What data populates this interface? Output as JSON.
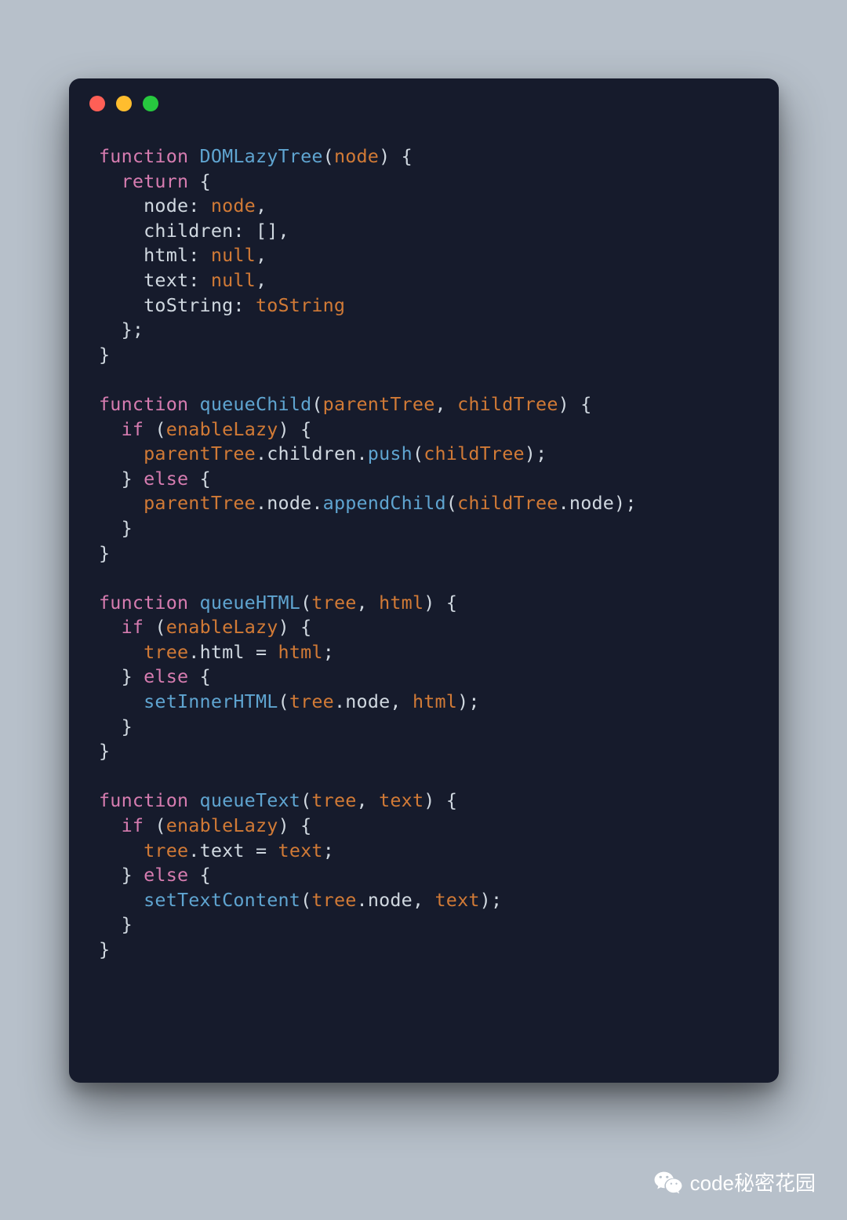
{
  "footer": {
    "text": "code秘密花园"
  },
  "code": {
    "tokens": [
      [
        {
          "t": "function ",
          "c": "kw"
        },
        {
          "t": "DOMLazyTree",
          "c": "fn"
        },
        {
          "t": "(",
          "c": "pn"
        },
        {
          "t": "node",
          "c": "prm"
        },
        {
          "t": ") {",
          "c": "pn"
        }
      ],
      [
        {
          "t": "  ",
          "c": "pn"
        },
        {
          "t": "return",
          "c": "kw"
        },
        {
          "t": " {",
          "c": "pn"
        }
      ],
      [
        {
          "t": "    node: ",
          "c": "pn"
        },
        {
          "t": "node",
          "c": "prm"
        },
        {
          "t": ",",
          "c": "pn"
        }
      ],
      [
        {
          "t": "    children: [],",
          "c": "pn"
        }
      ],
      [
        {
          "t": "    html: ",
          "c": "pn"
        },
        {
          "t": "null",
          "c": "nul"
        },
        {
          "t": ",",
          "c": "pn"
        }
      ],
      [
        {
          "t": "    text: ",
          "c": "pn"
        },
        {
          "t": "null",
          "c": "nul"
        },
        {
          "t": ",",
          "c": "pn"
        }
      ],
      [
        {
          "t": "    toString: ",
          "c": "pn"
        },
        {
          "t": "toString",
          "c": "prm"
        }
      ],
      [
        {
          "t": "  };",
          "c": "pn"
        }
      ],
      [
        {
          "t": "}",
          "c": "pn"
        }
      ],
      [
        {
          "t": "",
          "c": "pn"
        }
      ],
      [
        {
          "t": "function ",
          "c": "kw"
        },
        {
          "t": "queueChild",
          "c": "fn"
        },
        {
          "t": "(",
          "c": "pn"
        },
        {
          "t": "parentTree",
          "c": "prm"
        },
        {
          "t": ", ",
          "c": "pn"
        },
        {
          "t": "childTree",
          "c": "prm"
        },
        {
          "t": ") {",
          "c": "pn"
        }
      ],
      [
        {
          "t": "  ",
          "c": "pn"
        },
        {
          "t": "if",
          "c": "kw"
        },
        {
          "t": " (",
          "c": "pn"
        },
        {
          "t": "enableLazy",
          "c": "prm"
        },
        {
          "t": ") {",
          "c": "pn"
        }
      ],
      [
        {
          "t": "    ",
          "c": "pn"
        },
        {
          "t": "parentTree",
          "c": "prm"
        },
        {
          "t": ".children.",
          "c": "pn"
        },
        {
          "t": "push",
          "c": "fn"
        },
        {
          "t": "(",
          "c": "pn"
        },
        {
          "t": "childTree",
          "c": "prm"
        },
        {
          "t": ");",
          "c": "pn"
        }
      ],
      [
        {
          "t": "  } ",
          "c": "pn"
        },
        {
          "t": "else",
          "c": "kw"
        },
        {
          "t": " {",
          "c": "pn"
        }
      ],
      [
        {
          "t": "    ",
          "c": "pn"
        },
        {
          "t": "parentTree",
          "c": "prm"
        },
        {
          "t": ".node.",
          "c": "pn"
        },
        {
          "t": "appendChild",
          "c": "fn"
        },
        {
          "t": "(",
          "c": "pn"
        },
        {
          "t": "childTree",
          "c": "prm"
        },
        {
          "t": ".node);",
          "c": "pn"
        }
      ],
      [
        {
          "t": "  }",
          "c": "pn"
        }
      ],
      [
        {
          "t": "}",
          "c": "pn"
        }
      ],
      [
        {
          "t": "",
          "c": "pn"
        }
      ],
      [
        {
          "t": "function ",
          "c": "kw"
        },
        {
          "t": "queueHTML",
          "c": "fn"
        },
        {
          "t": "(",
          "c": "pn"
        },
        {
          "t": "tree",
          "c": "prm"
        },
        {
          "t": ", ",
          "c": "pn"
        },
        {
          "t": "html",
          "c": "prm"
        },
        {
          "t": ") {",
          "c": "pn"
        }
      ],
      [
        {
          "t": "  ",
          "c": "pn"
        },
        {
          "t": "if",
          "c": "kw"
        },
        {
          "t": " (",
          "c": "pn"
        },
        {
          "t": "enableLazy",
          "c": "prm"
        },
        {
          "t": ") {",
          "c": "pn"
        }
      ],
      [
        {
          "t": "    ",
          "c": "pn"
        },
        {
          "t": "tree",
          "c": "prm"
        },
        {
          "t": ".html = ",
          "c": "pn"
        },
        {
          "t": "html",
          "c": "prm"
        },
        {
          "t": ";",
          "c": "pn"
        }
      ],
      [
        {
          "t": "  } ",
          "c": "pn"
        },
        {
          "t": "else",
          "c": "kw"
        },
        {
          "t": " {",
          "c": "pn"
        }
      ],
      [
        {
          "t": "    ",
          "c": "pn"
        },
        {
          "t": "setInnerHTML",
          "c": "fn"
        },
        {
          "t": "(",
          "c": "pn"
        },
        {
          "t": "tree",
          "c": "prm"
        },
        {
          "t": ".node, ",
          "c": "pn"
        },
        {
          "t": "html",
          "c": "prm"
        },
        {
          "t": ");",
          "c": "pn"
        }
      ],
      [
        {
          "t": "  }",
          "c": "pn"
        }
      ],
      [
        {
          "t": "}",
          "c": "pn"
        }
      ],
      [
        {
          "t": "",
          "c": "pn"
        }
      ],
      [
        {
          "t": "function ",
          "c": "kw"
        },
        {
          "t": "queueText",
          "c": "fn"
        },
        {
          "t": "(",
          "c": "pn"
        },
        {
          "t": "tree",
          "c": "prm"
        },
        {
          "t": ", ",
          "c": "pn"
        },
        {
          "t": "text",
          "c": "prm"
        },
        {
          "t": ") {",
          "c": "pn"
        }
      ],
      [
        {
          "t": "  ",
          "c": "pn"
        },
        {
          "t": "if",
          "c": "kw"
        },
        {
          "t": " (",
          "c": "pn"
        },
        {
          "t": "enableLazy",
          "c": "prm"
        },
        {
          "t": ") {",
          "c": "pn"
        }
      ],
      [
        {
          "t": "    ",
          "c": "pn"
        },
        {
          "t": "tree",
          "c": "prm"
        },
        {
          "t": ".text = ",
          "c": "pn"
        },
        {
          "t": "text",
          "c": "prm"
        },
        {
          "t": ";",
          "c": "pn"
        }
      ],
      [
        {
          "t": "  } ",
          "c": "pn"
        },
        {
          "t": "else",
          "c": "kw"
        },
        {
          "t": " {",
          "c": "pn"
        }
      ],
      [
        {
          "t": "    ",
          "c": "pn"
        },
        {
          "t": "setTextContent",
          "c": "fn"
        },
        {
          "t": "(",
          "c": "pn"
        },
        {
          "t": "tree",
          "c": "prm"
        },
        {
          "t": ".node, ",
          "c": "pn"
        },
        {
          "t": "text",
          "c": "prm"
        },
        {
          "t": ");",
          "c": "pn"
        }
      ],
      [
        {
          "t": "  }",
          "c": "pn"
        }
      ],
      [
        {
          "t": "}",
          "c": "pn"
        }
      ]
    ]
  }
}
